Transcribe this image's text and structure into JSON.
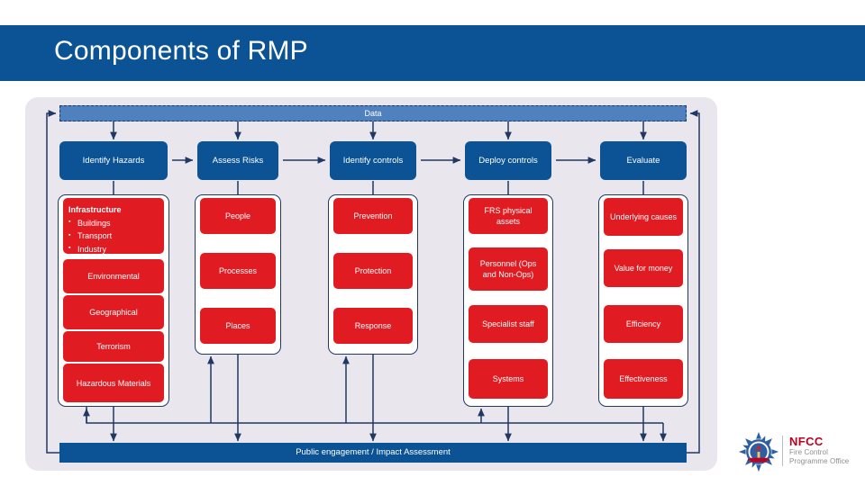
{
  "slide": {
    "title": "Components of RMP"
  },
  "diagram": {
    "data_bar_label": "Data",
    "bottom_bar_label": "Public engagement / Impact Assessment",
    "colors": {
      "header_blue": "#0B5394",
      "data_bar_blue": "#4E81BD",
      "red": "#E11B22",
      "panel_background": "#EAE6EE",
      "line": "#1F3864"
    },
    "columns": [
      {
        "id": "identify-hazards",
        "stage": "Identify Hazards",
        "items": [
          {
            "label": "Infrastructure",
            "bullets": [
              "Buildings",
              "Transport",
              "Industry"
            ]
          },
          {
            "label": "Environmental"
          },
          {
            "label": "Geographical"
          },
          {
            "label": "Terrorism"
          },
          {
            "label": "Hazardous Materials"
          }
        ]
      },
      {
        "id": "assess-risks",
        "stage": "Assess Risks",
        "items": [
          {
            "label": "People"
          },
          {
            "label": "Processes"
          },
          {
            "label": "Places"
          }
        ]
      },
      {
        "id": "identify-controls",
        "stage": "Identify controls",
        "items": [
          {
            "label": "Prevention"
          },
          {
            "label": "Protection"
          },
          {
            "label": "Response"
          }
        ]
      },
      {
        "id": "deploy-controls",
        "stage": "Deploy controls",
        "items": [
          {
            "label": "FRS physical assets"
          },
          {
            "label": "Personnel (Ops and Non-Ops)"
          },
          {
            "label": "Specialist staff"
          },
          {
            "label": "Systems"
          }
        ]
      },
      {
        "id": "evaluate",
        "stage": "Evaluate",
        "items": [
          {
            "label": "Underlying causes"
          },
          {
            "label": "Value for money"
          },
          {
            "label": "Efficiency"
          },
          {
            "label": "Effectiveness"
          }
        ]
      }
    ]
  },
  "logo": {
    "name": "NFCC",
    "line1": "Fire Control",
    "line2": "Programme Office"
  }
}
